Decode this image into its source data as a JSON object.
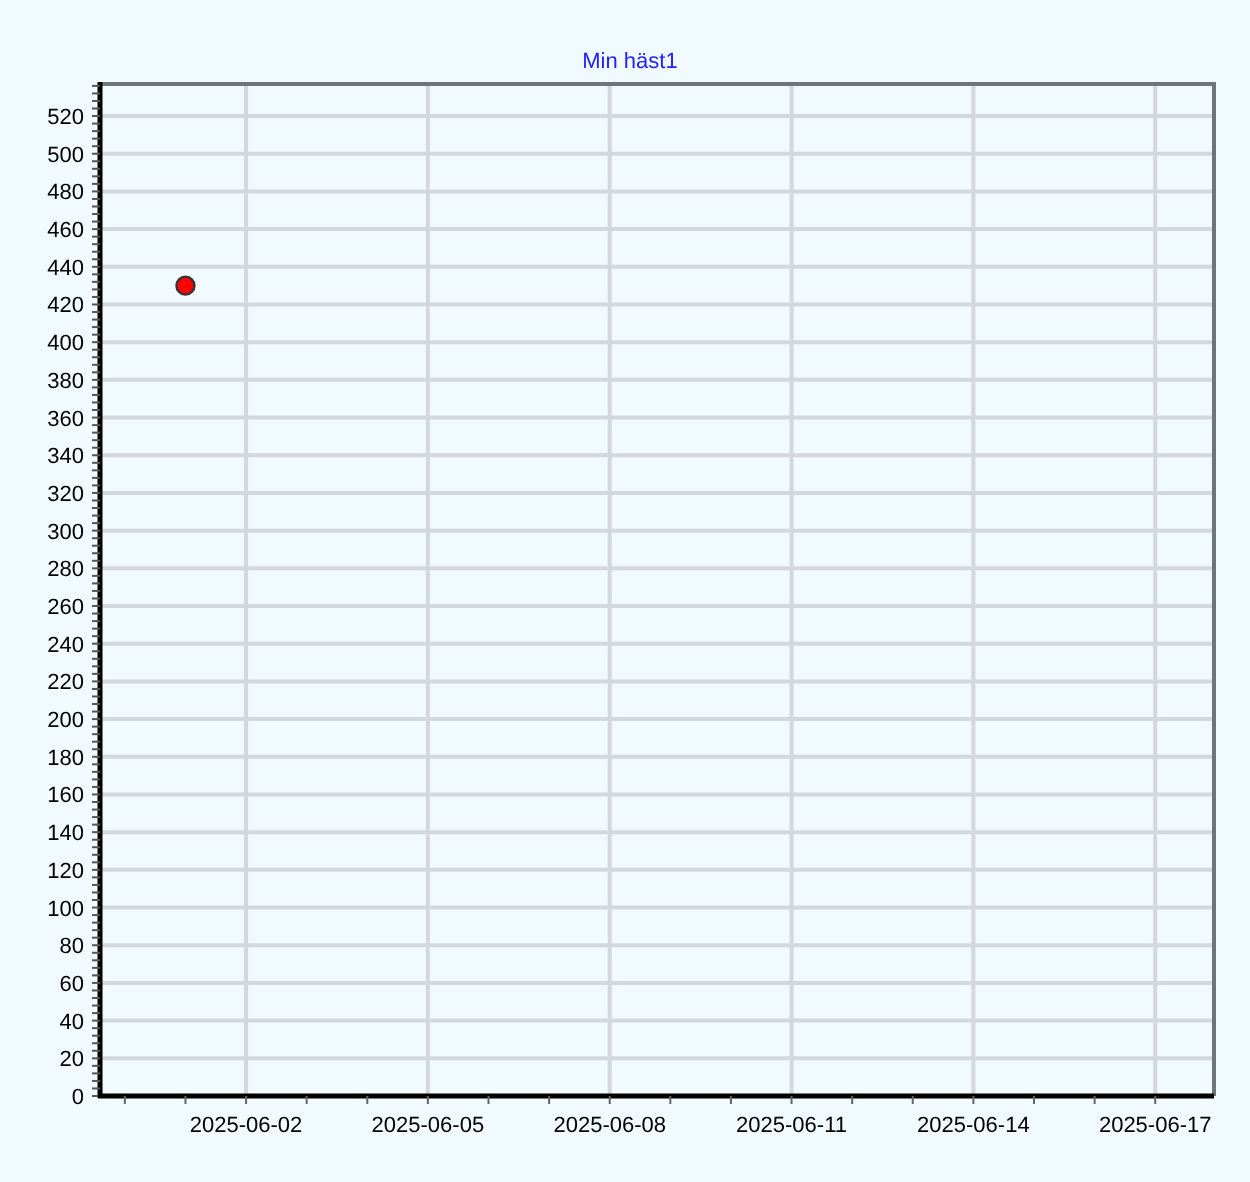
{
  "chart": {
    "chart_data": {
      "type": "scatter",
      "title": "Min häst1",
      "categories": [
        null,
        "2025-06-02",
        null,
        null,
        "2025-06-05",
        null,
        null,
        "2025-06-08",
        null,
        null,
        "2025-06-11",
        null,
        null,
        "2025-06-14",
        null,
        null,
        "2025-06-17"
      ],
      "series": [
        {
          "color": "#ff0000",
          "values": [
            430,
            null,
            null,
            null,
            null,
            null,
            null,
            null,
            null,
            null,
            null,
            null,
            null,
            null,
            null,
            null,
            null
          ]
        }
      ],
      "grid": true,
      "ylim": [
        0,
        537
      ],
      "yticks": [
        0,
        20,
        40,
        60,
        80,
        100,
        120,
        140,
        160,
        180,
        200,
        220,
        240,
        260,
        280,
        300,
        320,
        340,
        360,
        380,
        400,
        420,
        440,
        460,
        480,
        500,
        520
      ]
    }
  }
}
